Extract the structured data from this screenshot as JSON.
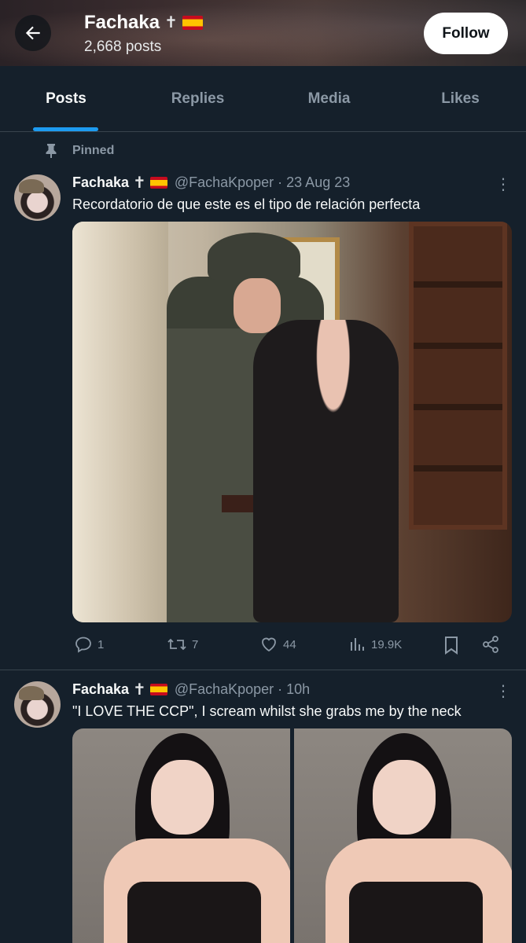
{
  "header": {
    "name": "Fachaka",
    "name_cross": "✝",
    "posts_count": "2,668 posts",
    "follow_label": "Follow"
  },
  "tabs": [
    {
      "label": "Posts",
      "active": true
    },
    {
      "label": "Replies",
      "active": false
    },
    {
      "label": "Media",
      "active": false
    },
    {
      "label": "Likes",
      "active": false
    }
  ],
  "pinned_label": "Pinned",
  "tweets": [
    {
      "name": "Fachaka",
      "cross": "✝",
      "handle": "@FachaKpoper",
      "separator": "·",
      "time": "23 Aug 23",
      "text": "Recordatorio de que este es el tipo de relación perfecta",
      "replies": "1",
      "retweets": "7",
      "likes": "44",
      "views": "19.9K"
    },
    {
      "name": "Fachaka",
      "cross": "✝",
      "handle": "@FachaKpoper",
      "separator": "·",
      "time": "10h",
      "text": "\"I LOVE THE CCP\", I scream whilst she grabs me by the neck"
    }
  ],
  "colors": {
    "background": "#15202b",
    "accent": "#1d9bf0",
    "muted": "#8b98a5",
    "divider": "#38444d"
  }
}
